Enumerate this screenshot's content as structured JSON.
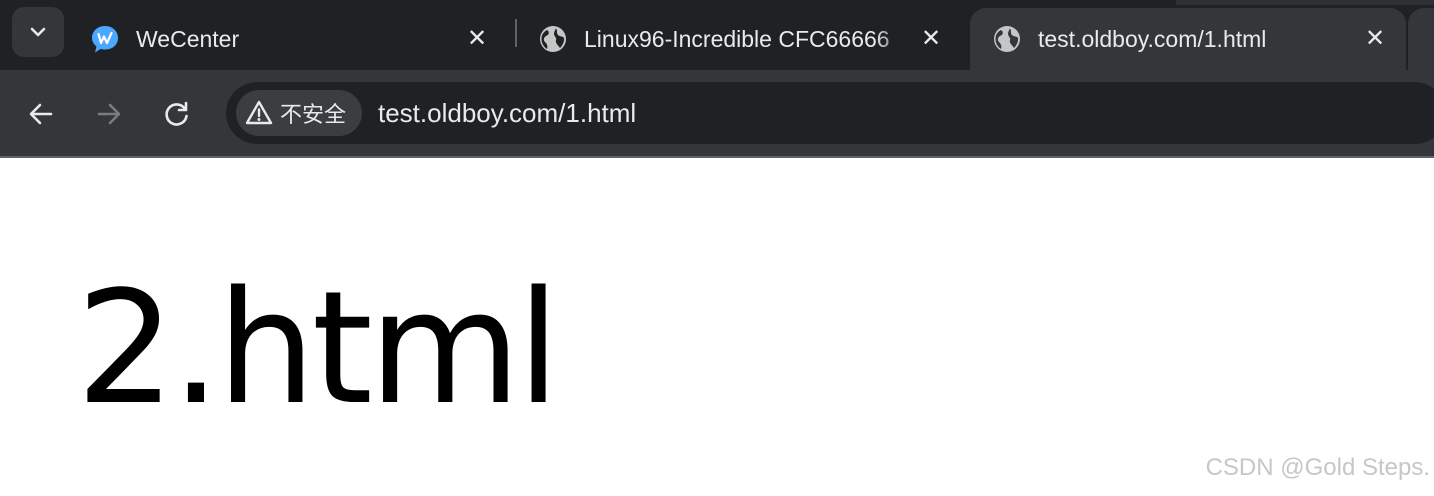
{
  "browser": {
    "tabs": [
      {
        "title": "WeCenter",
        "favicon": "wecenter-logo-icon",
        "active": false
      },
      {
        "title": "Linux96-Incredible  CFC66666",
        "favicon": "globe-icon",
        "active": false
      },
      {
        "title": "test.oldboy.com/1.html",
        "favicon": "globe-icon",
        "active": true
      }
    ],
    "close_glyph": "✕",
    "tab_search_icon": "chevron-down-icon",
    "toolbar": {
      "back_icon": "arrow-left-icon",
      "forward_icon": "arrow-right-icon",
      "reload_icon": "reload-icon"
    },
    "security_chip": {
      "icon": "warning-triangle-icon",
      "label": "不安全"
    },
    "url": "test.oldboy.com/1.html"
  },
  "page": {
    "heading": "2.html"
  },
  "watermark": "CSDN @Gold Steps.",
  "colors": {
    "tabstrip_bg": "#202124",
    "active_tab_bg": "#35363a",
    "omnibox_bg": "#202124",
    "text_light": "#e8eaed",
    "favicon_blue": "#4aa8ff"
  }
}
